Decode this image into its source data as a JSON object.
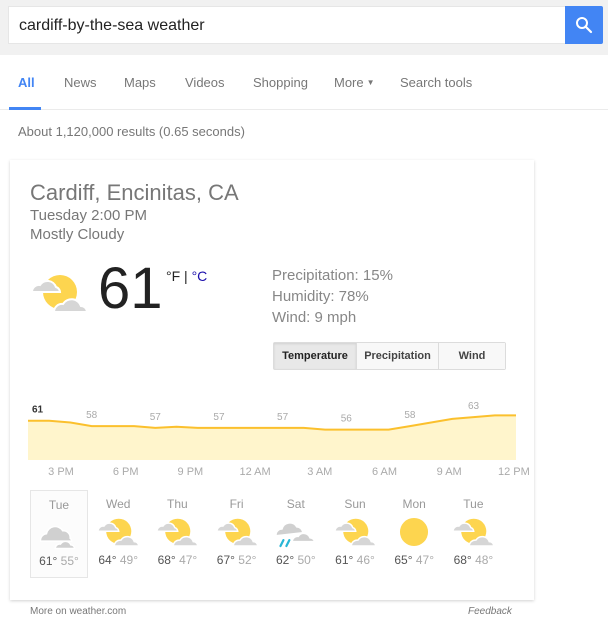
{
  "search": {
    "query": "cardiff-by-the-sea weather",
    "button_icon": "search-icon"
  },
  "tabs": [
    {
      "label": "All",
      "active": true
    },
    {
      "label": "News"
    },
    {
      "label": "Maps"
    },
    {
      "label": "Videos"
    },
    {
      "label": "Shopping"
    },
    {
      "label": "More",
      "caret": "▼"
    },
    {
      "label": "Search tools"
    }
  ],
  "result_stats": "About 1,120,000 results (0.65 seconds)",
  "weather": {
    "location": "Cardiff, Encinitas, CA",
    "time": "Tuesday 2:00 PM",
    "condition": "Mostly Cloudy",
    "current_icon": "partly-cloudy-icon",
    "temperature": "61",
    "unit_f": "°F",
    "unit_sep": " | ",
    "unit_c": "°C",
    "precipitation": "Precipitation: 15%",
    "humidity": "Humidity: 78%",
    "wind": "Wind: 9 mph",
    "segments": [
      {
        "label": "Temperature",
        "active": true
      },
      {
        "label": "Precipitation"
      },
      {
        "label": "Wind"
      }
    ],
    "accent": "#fbc02d",
    "fill": "#fff5cc"
  },
  "chart_data": {
    "type": "area",
    "title": "",
    "xlabel": "",
    "ylabel": "",
    "x_tick_labels": [
      "3 PM",
      "6 PM",
      "9 PM",
      "12 AM",
      "3 AM",
      "6 AM",
      "9 AM",
      "12 PM"
    ],
    "values": [
      61,
      61,
      60.5,
      59.5,
      59.5,
      59.5,
      59,
      59.3,
      59,
      59,
      59,
      59,
      59,
      59,
      58.5,
      58.5,
      58.5,
      58.5,
      59.5,
      60.5,
      61.5,
      62,
      62.5,
      62.5
    ],
    "labels": [
      {
        "index": 0,
        "text": "61",
        "bold": true
      },
      {
        "index": 3,
        "text": "58"
      },
      {
        "index": 6,
        "text": "57"
      },
      {
        "index": 9,
        "text": "57"
      },
      {
        "index": 12,
        "text": "57"
      },
      {
        "index": 15,
        "text": "56"
      },
      {
        "index": 18,
        "text": "58"
      },
      {
        "index": 21,
        "text": "63"
      }
    ],
    "ylim": [
      50,
      64
    ]
  },
  "forecast": [
    {
      "day": "Tue",
      "icon": "cloudy",
      "hi": "61°",
      "lo": "55°",
      "selected": true
    },
    {
      "day": "Wed",
      "icon": "partly-cloudy",
      "hi": "64°",
      "lo": "49°"
    },
    {
      "day": "Thu",
      "icon": "partly-cloudy",
      "hi": "68°",
      "lo": "47°"
    },
    {
      "day": "Fri",
      "icon": "partly-cloudy",
      "hi": "67°",
      "lo": "52°"
    },
    {
      "day": "Sat",
      "icon": "rain",
      "hi": "62°",
      "lo": "50°"
    },
    {
      "day": "Sun",
      "icon": "partly-cloudy",
      "hi": "61°",
      "lo": "46°"
    },
    {
      "day": "Mon",
      "icon": "sunny",
      "hi": "65°",
      "lo": "47°"
    },
    {
      "day": "Tue",
      "icon": "partly-cloudy",
      "hi": "68°",
      "lo": "48°"
    }
  ],
  "footer": {
    "more_link": "More on weather.com",
    "feedback": "Feedback"
  }
}
